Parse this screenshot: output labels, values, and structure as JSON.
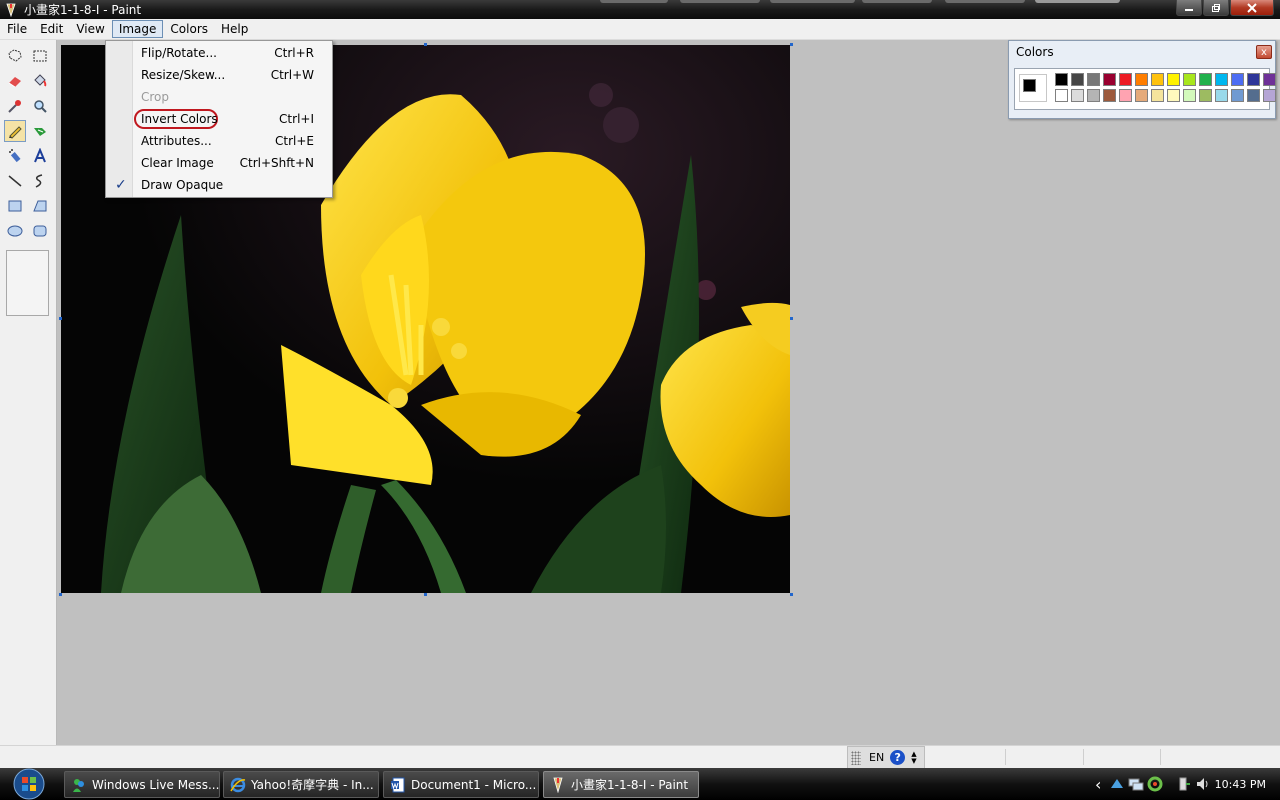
{
  "window": {
    "title": "小畫家1-1-8-I - Paint",
    "controls": [
      "minimize",
      "restore",
      "close"
    ]
  },
  "menubar": {
    "items": [
      "File",
      "Edit",
      "View",
      "Image",
      "Colors",
      "Help"
    ],
    "active": "Image"
  },
  "image_menu": {
    "items": [
      {
        "label": "Flip/Rotate...",
        "shortcut": "Ctrl+R",
        "enabled": true
      },
      {
        "label": "Resize/Skew...",
        "shortcut": "Ctrl+W",
        "enabled": true
      },
      {
        "label": "Crop",
        "shortcut": "",
        "enabled": false
      },
      {
        "label": "Invert Colors",
        "shortcut": "Ctrl+I",
        "enabled": true,
        "highlighted": true
      },
      {
        "label": "Attributes...",
        "shortcut": "Ctrl+E",
        "enabled": true
      },
      {
        "label": "Clear Image",
        "shortcut": "Ctrl+Shft+N",
        "enabled": true
      },
      {
        "label": "Draw Opaque",
        "shortcut": "",
        "enabled": true,
        "checked": true
      }
    ],
    "check_glyph": "✓"
  },
  "toolbox": {
    "tools": [
      "free-form-select",
      "select",
      "eraser",
      "fill-with-color",
      "pick-color",
      "magnifier",
      "pencil",
      "brush",
      "airbrush",
      "text",
      "line",
      "curve",
      "rectangle",
      "polygon",
      "ellipse",
      "rounded-rectangle"
    ],
    "selected": "pencil"
  },
  "canvas": {
    "image_subject": "yellow tulips on black background"
  },
  "colors_window": {
    "title": "Colors",
    "close_glyph": "x",
    "foreground": "#000000",
    "background": "#ffffff",
    "row1": [
      "#000000",
      "#464646",
      "#787878",
      "#990030",
      "#ed1c24",
      "#ff7e00",
      "#ffc20e",
      "#fff200",
      "#a8e61d",
      "#22b14c",
      "#00b7ef",
      "#4d6df3",
      "#2f3699",
      "#6f3198"
    ],
    "row2": [
      "#ffffff",
      "#dcdcdc",
      "#b4b4b4",
      "#9c5a3c",
      "#ffa3b1",
      "#e5aa7a",
      "#f5e49c",
      "#fff9bd",
      "#d3f9bc",
      "#9dbb61",
      "#99d9ea",
      "#709ad1",
      "#546d8e",
      "#b5a5d5"
    ]
  },
  "statusbar": {
    "language": "EN",
    "help_glyph": "?"
  },
  "taskbar": {
    "buttons": [
      {
        "label": "Windows Live Mess...",
        "icon": "messenger-icon",
        "active": false
      },
      {
        "label": "Yahoo!奇摩字典 - In...",
        "icon": "internet-explorer-icon",
        "active": false
      },
      {
        "label": "Document1 - Micro...",
        "icon": "word-icon",
        "active": false
      },
      {
        "label": "小畫家1-1-8-I - Paint",
        "icon": "paint-icon",
        "active": true
      }
    ],
    "tray_arrow": "‹",
    "clock": "10:43 PM"
  }
}
